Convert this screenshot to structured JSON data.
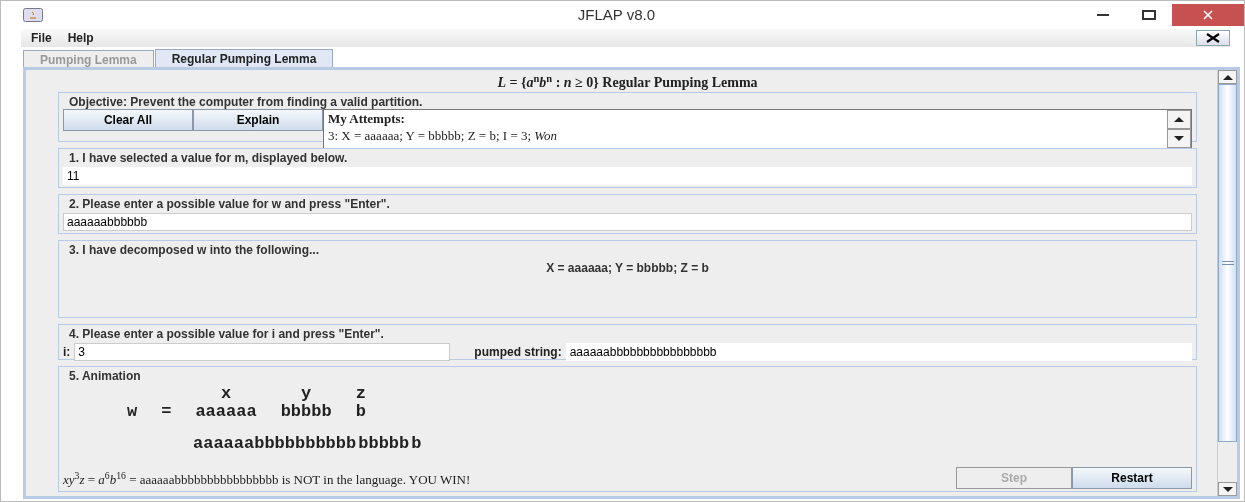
{
  "window": {
    "title": "JFLAP v8.0"
  },
  "menu": [
    "File",
    "Help"
  ],
  "tabs": [
    {
      "label": "Pumping Lemma",
      "selected": false
    },
    {
      "label": "Regular Pumping Lemma",
      "selected": true
    }
  ],
  "heading": "*L* = {*a*$^{n}$*b*$^{n}$ : *n* ≥ 0} Regular Pumping Lemma",
  "objective": {
    "legend": "Objective: Prevent the computer from finding a valid partition.",
    "buttons": [
      "Clear All",
      "Explain"
    ],
    "attempts_title": "My Attempts:",
    "attempts": [
      "3: X = aaaaaa; Y = bbbbb; Z = b; I = 3; *Won*"
    ]
  },
  "step1": {
    "legend": "1. I have selected a value for m, displayed below.",
    "value": "11"
  },
  "step2": {
    "legend": "2. Please enter a possible value for w and press \"Enter\".",
    "value": "aaaaaabbbbbb"
  },
  "step3": {
    "legend": "3. I have decomposed w into the following...",
    "decomposition": "X = aaaaaa; Y = bbbbb; Z = b"
  },
  "step4": {
    "legend": "4. Please enter a possible value for i and press \"Enter\".",
    "i_label": "i:",
    "i_value": "3",
    "pumped_label": "pumped string:",
    "pumped_value": "aaaaaabbbbbbbbbbbbbbbb"
  },
  "step5": {
    "legend": "5. Animation",
    "w_label": "w",
    "equals": "=",
    "parts": [
      {
        "name": "x",
        "value": "aaaaaa"
      },
      {
        "name": "y",
        "value": "bbbbb"
      },
      {
        "name": "z",
        "value": "b"
      }
    ],
    "pumped": [
      "aaaaaabbbbbbbbbb",
      "bbbbb",
      "b"
    ],
    "result": "*xy*$^{3}$*z* = *a*$^{6}$*b*$^{16}$ = aaaaaabbbbbbbbbbbbbbbb is NOT in the language. YOU WIN!",
    "buttons": [
      {
        "label": "Step",
        "disabled": true
      },
      {
        "label": "Restart",
        "disabled": false
      }
    ]
  }
}
